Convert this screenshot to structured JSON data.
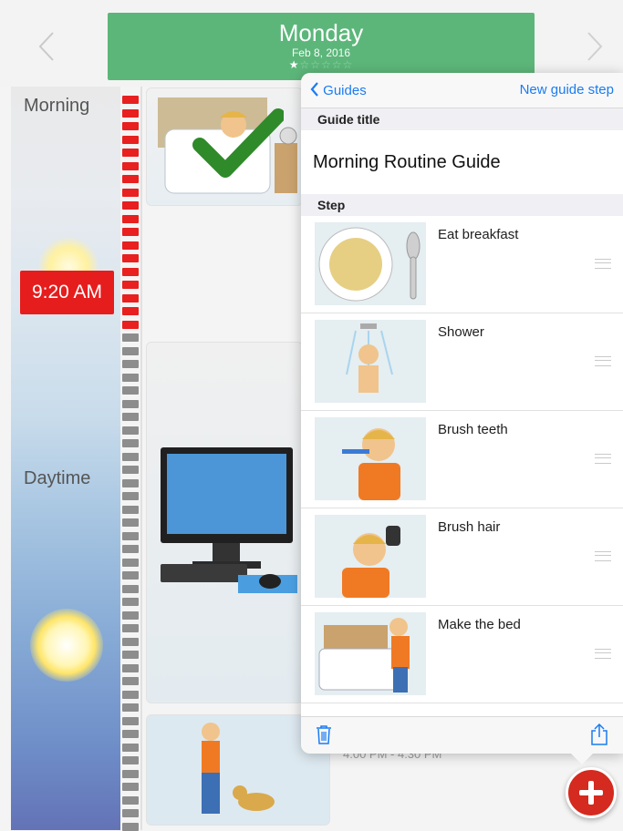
{
  "header": {
    "day": "Monday",
    "date": "Feb 8, 2016",
    "rating": {
      "filled": 1,
      "total": 6
    }
  },
  "timeline": {
    "periods": [
      "Morning",
      "Daytime"
    ],
    "current_time": "9:20 AM",
    "event_time": "4:00 PM - 4:30 PM"
  },
  "popover": {
    "back_label": "Guides",
    "new_step_label": "New guide step",
    "guide_title_header": "Guide title",
    "guide_title": "Morning Routine Guide",
    "step_header": "Step",
    "steps": [
      {
        "label": "Eat breakfast"
      },
      {
        "label": "Shower"
      },
      {
        "label": "Brush teeth"
      },
      {
        "label": "Brush hair"
      },
      {
        "label": "Make the bed"
      }
    ]
  },
  "colors": {
    "accent_green": "#5cb67a",
    "time_red": "#e61d1d",
    "ios_blue": "#1a7cf2",
    "fab_red": "#d42a1f"
  },
  "icons": [
    "chevron-left-icon",
    "chevron-right-icon",
    "checkmark-icon",
    "trash-icon",
    "share-icon",
    "plus-icon"
  ]
}
